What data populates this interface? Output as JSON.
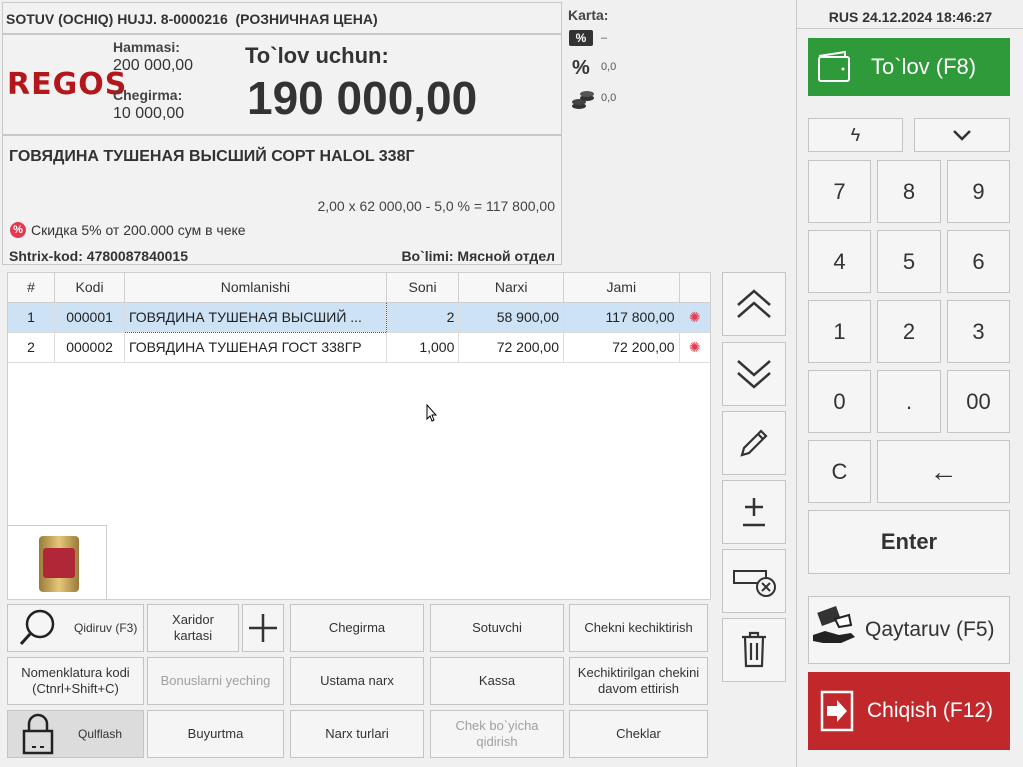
{
  "header": {
    "doc_title": "SOTUV (OCHIQ) HUJJ. 8-0000216  (РОЗНИЧНАЯ ЦЕНА)",
    "datetime": "RUS 24.12.2024 18:46:27"
  },
  "logo": "REGOS",
  "totals": {
    "total_label": "Hammasi:",
    "total_value": "200 000,00",
    "discount_label": "Chegirma:",
    "discount_value": "10 000,00",
    "pay_label": "To`lov uchun:",
    "pay_value": "190 000,00"
  },
  "card": {
    "label": "Karta:",
    "percent_badge_value": "–",
    "percent_value": "0,0",
    "coins_value": "0,0"
  },
  "product": {
    "name": "ГОВЯДИНА ТУШЕНАЯ ВЫСШИЙ СОРТ HALOL 338Г",
    "calc": "2,00 x 62 000,00 - 5,0 % = 117 800,00",
    "promo": "Скидка 5% от 200.000 сум в чеке",
    "barcode": "Shtrix-kod: 4780087840015",
    "department": "Bo`limi: Мясной отдел"
  },
  "table": {
    "headers": [
      "#",
      "Kodi",
      "Nomlanishi",
      "Soni",
      "Narxi",
      "Jami"
    ],
    "rows": [
      {
        "n": "1",
        "code": "000001",
        "name": "ГОВЯДИНА ТУШЕНАЯ ВЫСШИЙ ...",
        "qty": "2",
        "price": "58 900,00",
        "sum": "117 800,00"
      },
      {
        "n": "2",
        "code": "000002",
        "name": "ГОВЯДИНА ТУШЕНАЯ ГОСТ 338ГР",
        "qty": "1,000",
        "price": "72 200,00",
        "sum": "72 200,00"
      }
    ]
  },
  "buttons": {
    "search": "Qidiruv (F3)",
    "customer_card": "Xaridor kartasi",
    "discount": "Chegirma",
    "seller": "Sotuvchi",
    "delay_check": "Chekni kechiktirish",
    "nomenclature_code": "Nomenklatura kodi (Ctnrl+Shift+C)",
    "remove_bonus": "Bonuslarni yeching",
    "master_price": "Ustama narx",
    "cash": "Kassa",
    "continue_delayed": "Kechiktirilgan chekini davom ettirish",
    "lock": "Qulflash",
    "order": "Buyurtma",
    "price_types": "Narx turlari",
    "search_by_check": "Chek bo`yicha qidirish",
    "checks": "Cheklar"
  },
  "keypad": {
    "pay": "To`lov (F8)",
    "keys": [
      "7",
      "8",
      "9",
      "4",
      "5",
      "6",
      "1",
      "2",
      "3",
      "0",
      ".",
      "00",
      "C"
    ],
    "backspace": "←",
    "enter": "Enter",
    "return": "Qaytaruv (F5)",
    "exit": "Chiqish (F12)"
  },
  "colors": {
    "pay_green": "#2f9a3a",
    "exit_red": "#c0282b",
    "logo_red": "#b3171c",
    "selected_row": "#cde3f5"
  }
}
